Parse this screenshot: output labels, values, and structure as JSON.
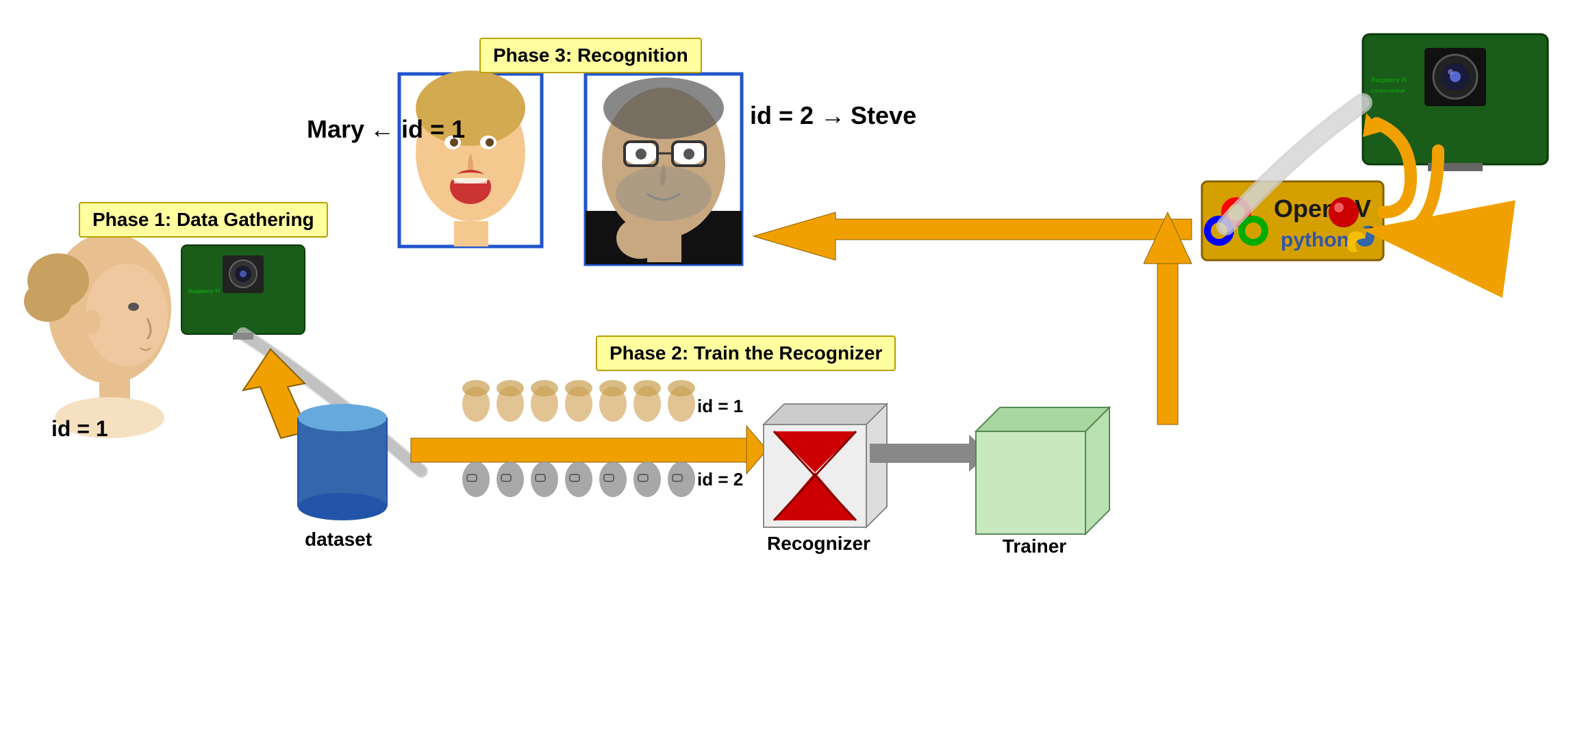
{
  "phases": {
    "phase1": "Phase 1: Data Gathering",
    "phase2": "Phase 2: Train the Recognizer",
    "phase3": "Phase 3: Recognition"
  },
  "labels": {
    "mary": "Mary",
    "steve": "Steve",
    "id1_mary": "← id = 1",
    "id2_steve": "id = 2 →",
    "id1_woman": "id = 1",
    "dataset": "dataset",
    "recognizer": "Recognizer",
    "trainer": "Trainer",
    "id1_row": "id = 1",
    "id2_row": "id = 2",
    "opencv": "OpenCV",
    "python": "python"
  }
}
